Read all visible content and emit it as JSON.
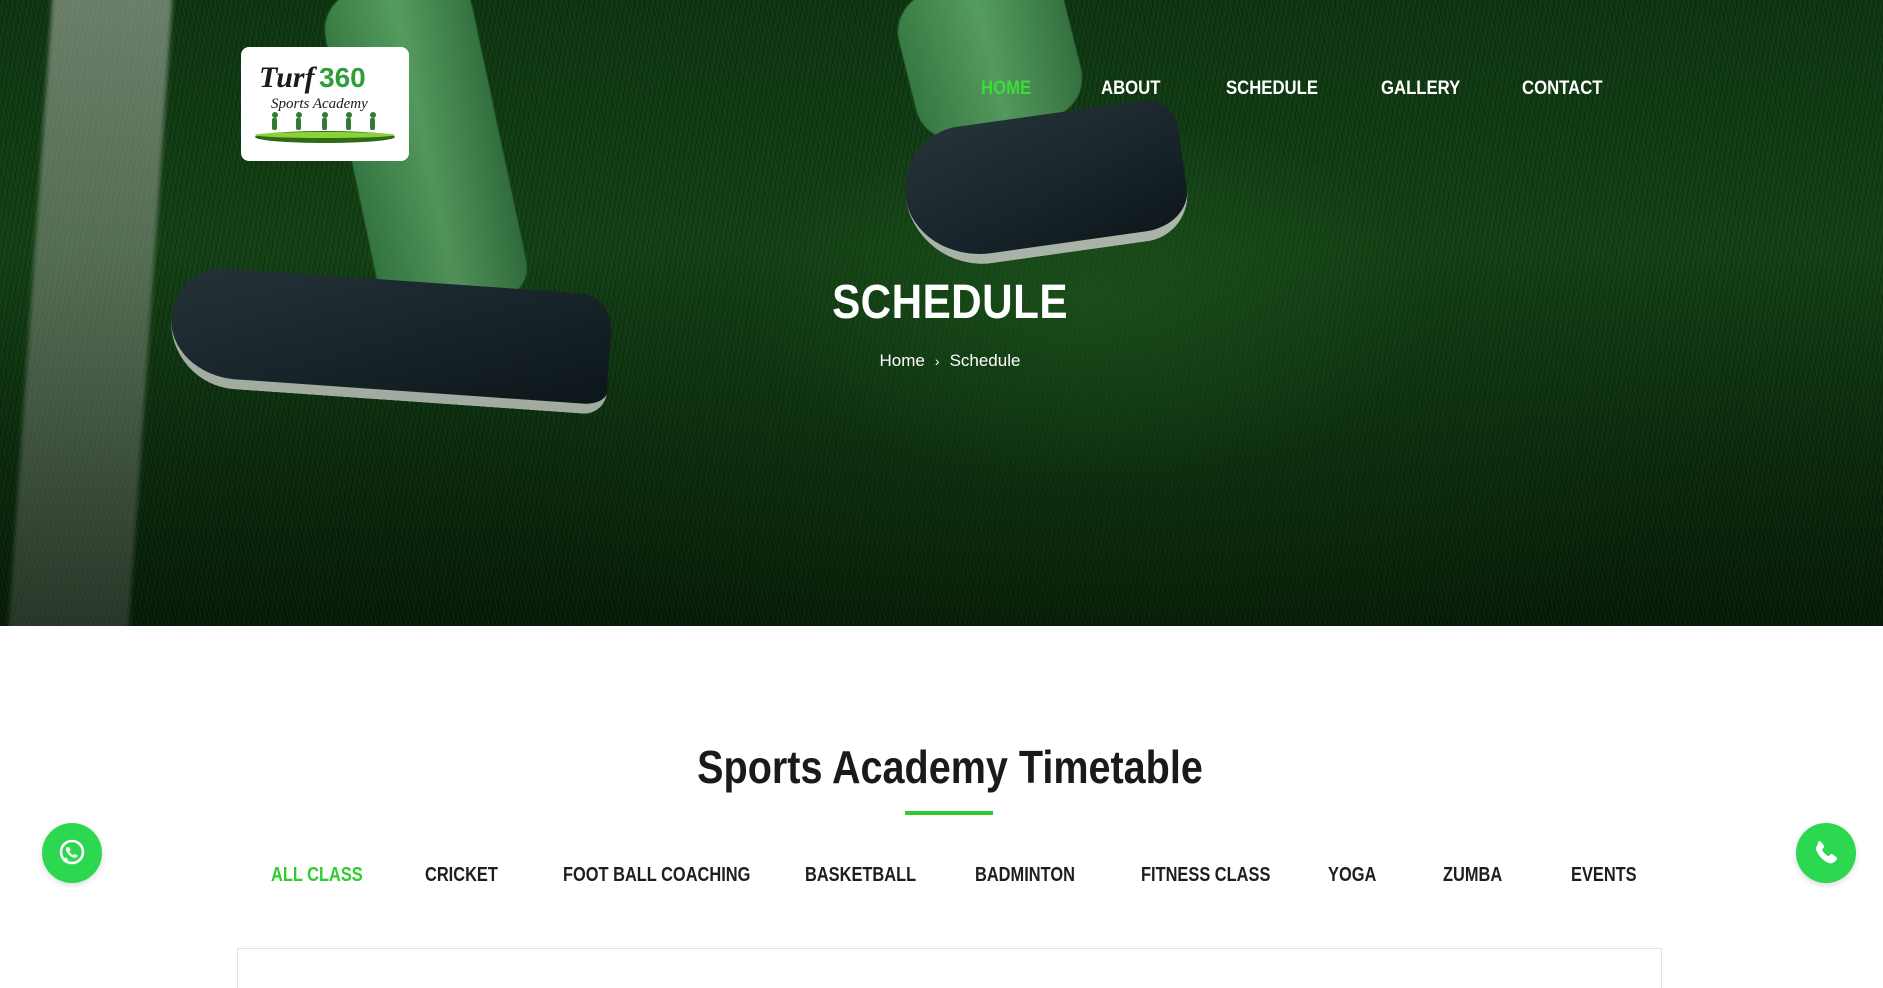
{
  "brand": {
    "logo_line1": "Turf 360",
    "logo_line2": "Sports Academy",
    "accent_color": "#3ddc3d",
    "fab_color": "#2bd84f"
  },
  "nav": {
    "items": [
      {
        "label": "HOME",
        "active": true
      },
      {
        "label": "ABOUT",
        "active": false
      },
      {
        "label": "SCHEDULE",
        "active": false
      },
      {
        "label": "GALLERY",
        "active": false
      },
      {
        "label": "CONTACT",
        "active": false
      }
    ]
  },
  "hero": {
    "title": "SCHEDULE",
    "breadcrumb": {
      "home": "Home",
      "separator": "›",
      "current": "Schedule"
    }
  },
  "timetable": {
    "title": "Sports Academy Timetable",
    "filters": [
      {
        "label": "ALL CLASS",
        "active": true
      },
      {
        "label": "CRICKET",
        "active": false
      },
      {
        "label": "FOOT BALL COACHING",
        "active": false
      },
      {
        "label": "BASKETBALL",
        "active": false
      },
      {
        "label": "BADMINTON",
        "active": false
      },
      {
        "label": "FITNESS CLASS",
        "active": false
      },
      {
        "label": "YOGA",
        "active": false
      },
      {
        "label": "ZUMBA",
        "active": false
      },
      {
        "label": "EVENTS",
        "active": false
      }
    ]
  },
  "floating": {
    "left_icon": "whatsapp-icon",
    "right_icon": "phone-icon"
  }
}
